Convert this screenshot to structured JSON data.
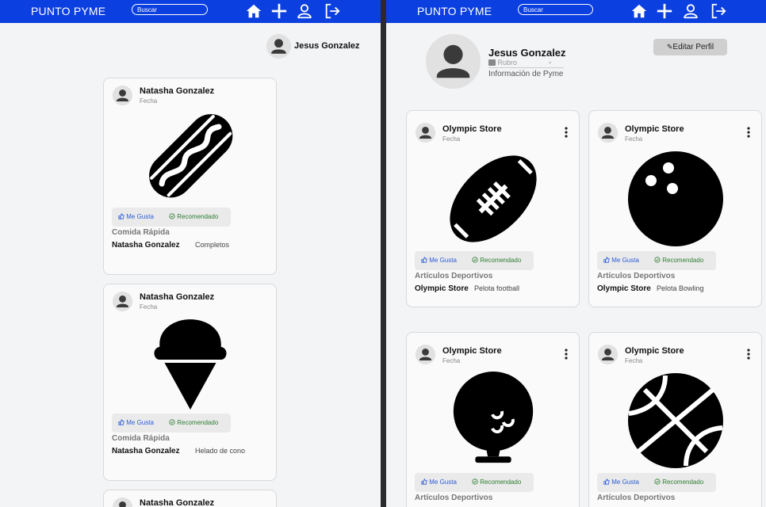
{
  "nav": {
    "brand": "PUNTO PYME",
    "search_placeholder": "Buscar"
  },
  "left": {
    "header_user": "Jesus Gonzalez",
    "posts": [
      {
        "author": "Natasha Gonzalez",
        "date": "Fecha",
        "like": "Me Gusta",
        "recommend": "Recomendado",
        "category": "Comida Rápida",
        "owner": "Natasha Gonzalez",
        "product": "Completos",
        "image": "hotdog-icon"
      },
      {
        "author": "Natasha Gonzalez",
        "date": "Fecha",
        "like": "Me Gusta",
        "recommend": "Recomendado",
        "category": "Comida Rápida",
        "owner": "Natasha Gonzalez",
        "product": "Helado de cono",
        "image": "ice-cream-icon"
      },
      {
        "author": "Natasha Gonzalez"
      }
    ]
  },
  "right": {
    "profile": {
      "name": "Jesus Gonzalez",
      "rubro_placeholder": "Rubro",
      "info": "Información de Pyme",
      "edit_label": "Editar Perfil"
    },
    "posts": [
      {
        "author": "Olympic Store",
        "date": "Fecha",
        "like": "Me Gusta",
        "recommend": "Recomendado",
        "category": "Artículos Deportivos",
        "owner": "Olympic Store",
        "product": "Pelota football",
        "image": "football-icon"
      },
      {
        "author": "Olympic Store",
        "date": "Fecha",
        "like": "Me Gusta",
        "recommend": "Recomendado",
        "category": "Artículos Deportivos",
        "owner": "Olympic Store",
        "product": "Pelota Bowling",
        "image": "bowling-ball-icon"
      },
      {
        "author": "Olympic Store",
        "date": "Fecha",
        "like": "Me Gusta",
        "recommend": "Recomendado",
        "category": "Artículos Deportivos",
        "image": "golf-ball-icon"
      },
      {
        "author": "Olympic Store",
        "date": "Fecha",
        "like": "Me Gusta",
        "recommend": "Recomendado",
        "category": "Artículos Deportivos",
        "image": "basketball-icon"
      }
    ]
  },
  "colors": {
    "nav": "#0b3fe0",
    "like": "#2a5bd7",
    "recommend": "#2e7d32"
  }
}
